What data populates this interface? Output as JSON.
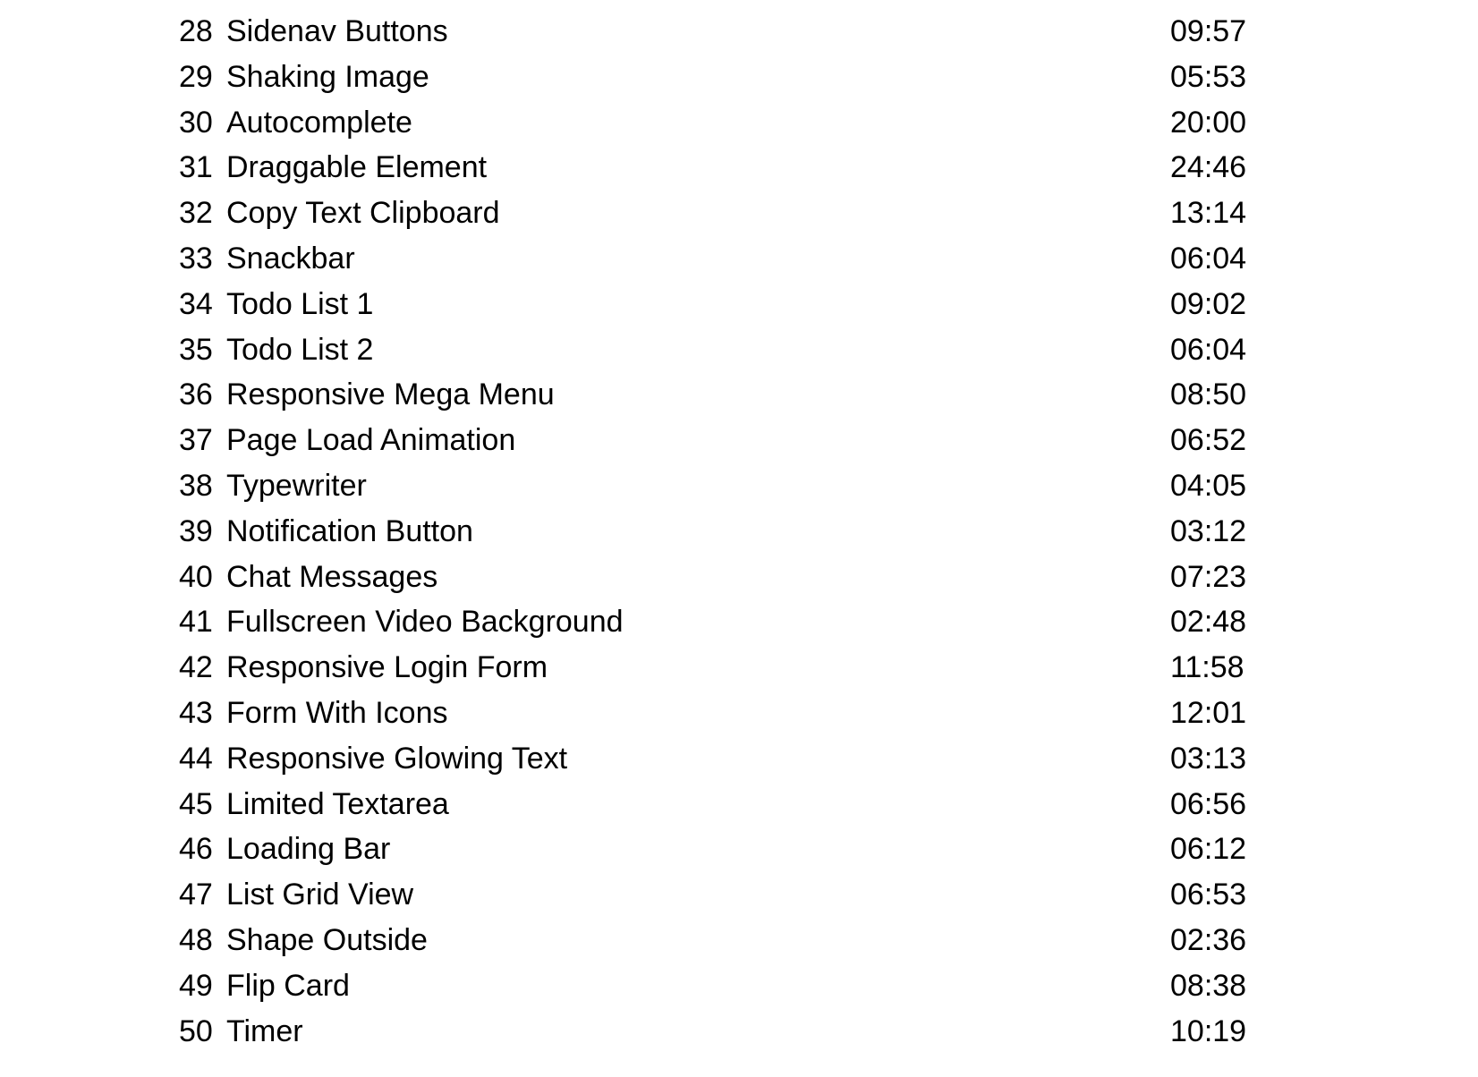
{
  "lessons": [
    {
      "num": "28",
      "title": "Sidenav Buttons",
      "duration": "09:57"
    },
    {
      "num": "29",
      "title": "Shaking Image",
      "duration": "05:53"
    },
    {
      "num": "30",
      "title": "Autocomplete",
      "duration": "20:00"
    },
    {
      "num": "31",
      "title": "Draggable Element",
      "duration": "24:46"
    },
    {
      "num": "32",
      "title": "Copy Text Clipboard",
      "duration": "13:14"
    },
    {
      "num": "33",
      "title": "Snackbar",
      "duration": "06:04"
    },
    {
      "num": "34",
      "title": "Todo List 1",
      "duration": "09:02"
    },
    {
      "num": "35",
      "title": "Todo List 2",
      "duration": "06:04"
    },
    {
      "num": "36",
      "title": "Responsive Mega Menu",
      "duration": "08:50"
    },
    {
      "num": "37",
      "title": "Page Load Animation",
      "duration": "06:52"
    },
    {
      "num": "38",
      "title": "Typewriter",
      "duration": "04:05"
    },
    {
      "num": "39",
      "title": "Notification Button",
      "duration": "03:12"
    },
    {
      "num": "40",
      "title": "Chat Messages",
      "duration": "07:23"
    },
    {
      "num": "41",
      "title": "Fullscreen Video Background",
      "duration": "02:48"
    },
    {
      "num": "42",
      "title": "Responsive Login Form",
      "duration": "11:58"
    },
    {
      "num": "43",
      "title": "Form With Icons",
      "duration": "12:01"
    },
    {
      "num": "44",
      "title": "Responsive Glowing Text",
      "duration": "03:13"
    },
    {
      "num": "45",
      "title": "Limited Textarea",
      "duration": "06:56"
    },
    {
      "num": "46",
      "title": "Loading Bar",
      "duration": "06:12"
    },
    {
      "num": "47",
      "title": "List Grid View",
      "duration": "06:53"
    },
    {
      "num": "48",
      "title": "Shape Outside",
      "duration": "02:36"
    },
    {
      "num": "49",
      "title": "Flip Card",
      "duration": "08:38"
    },
    {
      "num": "50",
      "title": "Timer",
      "duration": "10:19"
    }
  ]
}
